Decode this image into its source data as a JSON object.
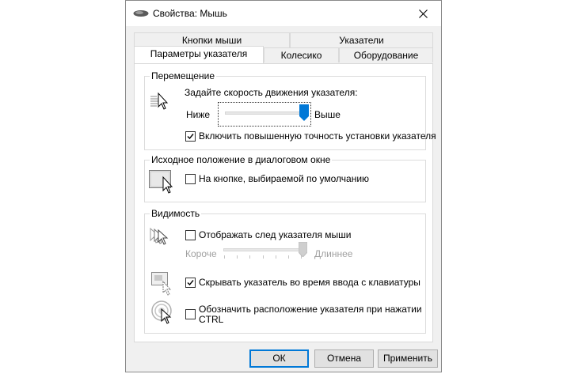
{
  "window": {
    "title": "Свойства: Мышь"
  },
  "tabs": {
    "row1": [
      "Кнопки мыши",
      "Указатели"
    ],
    "row2": [
      "Параметры указателя",
      "Колесико",
      "Оборудование"
    ]
  },
  "motion": {
    "title": "Перемещение",
    "speed_label": "Задайте скорость движения указателя:",
    "slow": "Ниже",
    "fast": "Выше",
    "speed_level": 1.0,
    "precision_label": "Включить повышенную точность установки указателя",
    "precision_checked": true
  },
  "snap": {
    "title": "Исходное положение в диалоговом окне",
    "label": "На кнопке, выбираемой по умолчанию",
    "checked": false
  },
  "visibility": {
    "title": "Видимость",
    "trails_label": "Отображать след указателя мыши",
    "trails_checked": false,
    "short": "Короче",
    "long": "Длиннее",
    "trails_level": 1.0,
    "hide_label": "Скрывать указатель во время ввода с клавиатуры",
    "hide_checked": true,
    "ctrl_label_line1": "Обозначить расположение указателя при нажатии",
    "ctrl_label_line2": "CTRL",
    "ctrl_checked": false
  },
  "buttons": {
    "ok": "ОК",
    "cancel": "Отмена",
    "apply": "Применить"
  },
  "colors": {
    "accent": "#0078d7"
  }
}
